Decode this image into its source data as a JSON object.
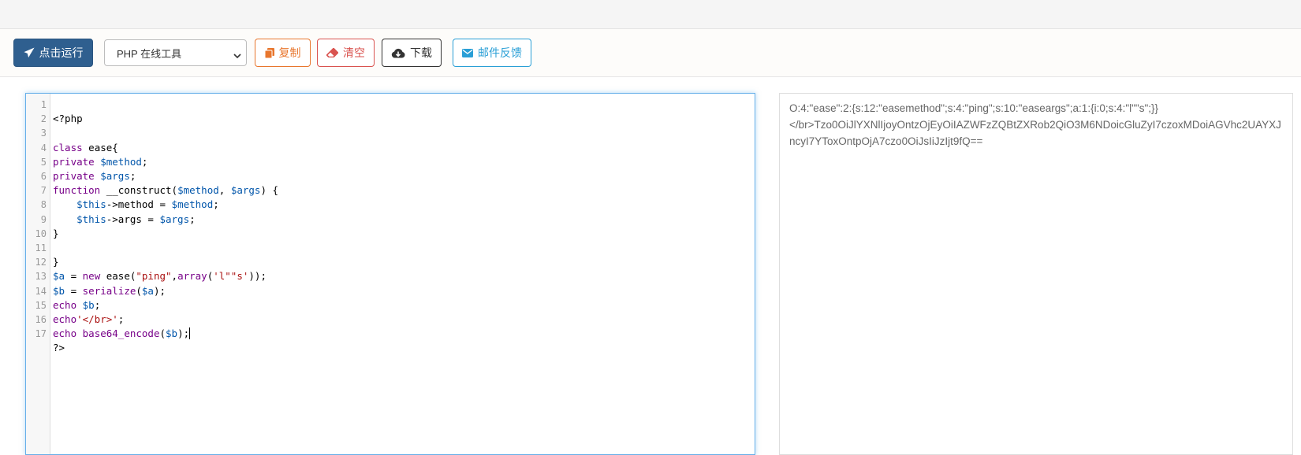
{
  "toolbar": {
    "run_label": "点击运行",
    "select_value": "PHP 在线工具",
    "copy_label": "复制",
    "clear_label": "清空",
    "download_label": "下载",
    "feedback_label": "邮件反馈"
  },
  "editor": {
    "line_numbers": [
      "1",
      "2",
      "3",
      "4",
      "5",
      "6",
      "7",
      "8",
      "9",
      "10",
      "11",
      "12",
      "13",
      "14",
      "15",
      "16",
      "17"
    ]
  },
  "output": {
    "line1": "O:4:\"ease\":2:{s:12:\"easemethod\";s:4:\"ping\";s:10:\"easeargs\";a:1:{i:0;s:4:\"l\"\"s\";}}",
    "line2": "</br>Tzo0OiJlYXNlIjoyOntzOjEyOiIAZWFzZQBtZXRob2QiO3M6NDoicGluZyI7czoxMDoiAGVhc2UAYXJncyI7YToxOntpOjA7czo0OiJsIiJzIjt9fQ=="
  },
  "colors": {
    "run_bg": "#2f5f8f",
    "copy": "#e8762d",
    "clear": "#d9534f",
    "feedback": "#2a9fd6",
    "editor_focus_border": "#66afe9"
  },
  "icons": [
    "paper-plane-icon",
    "copy-icon",
    "eraser-icon",
    "cloud-download-icon",
    "envelope-icon",
    "chevron-down-icon"
  ]
}
